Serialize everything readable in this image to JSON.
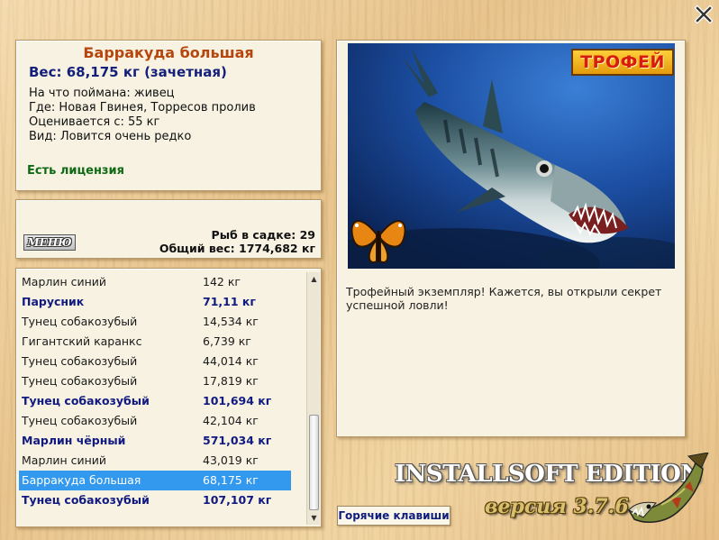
{
  "window": {
    "close_icon": "close-x-icon"
  },
  "info": {
    "title": "Барракуда большая",
    "weight_line": "Вес: 68,175 кг (зачетная)",
    "lines": [
      "На что поймана: живец",
      "Где: Новая Гвинея, Торресов пролив",
      "Оценивается с: 55 кг",
      "Вид: Ловится очень редко"
    ],
    "license": "Есть лицензия"
  },
  "stats": {
    "menu_label": "МЕНЮ",
    "fish_count": "Рыб в садке: 29",
    "total_weight": "Общий вес: 1774,682 кг"
  },
  "catch_list": {
    "rows": [
      {
        "name": "Марлин синий",
        "weight": "142 кг",
        "bold": false,
        "selected": false
      },
      {
        "name": "Парусник",
        "weight": "71,11 кг",
        "bold": true,
        "selected": false
      },
      {
        "name": "Тунец собакозубый",
        "weight": "14,534 кг",
        "bold": false,
        "selected": false
      },
      {
        "name": "Гигантский каранкс",
        "weight": "6,739 кг",
        "bold": false,
        "selected": false
      },
      {
        "name": "Тунец собакозубый",
        "weight": "44,014 кг",
        "bold": false,
        "selected": false
      },
      {
        "name": "Тунец собакозубый",
        "weight": "17,819 кг",
        "bold": false,
        "selected": false
      },
      {
        "name": "Тунец собакозубый",
        "weight": "101,694 кг",
        "bold": true,
        "selected": false
      },
      {
        "name": "Тунец собакозубый",
        "weight": "42,104 кг",
        "bold": false,
        "selected": false
      },
      {
        "name": "Марлин чёрный",
        "weight": "571,034 кг",
        "bold": true,
        "selected": false
      },
      {
        "name": "Марлин синий",
        "weight": "43,019 кг",
        "bold": false,
        "selected": false
      },
      {
        "name": "Барракуда большая",
        "weight": "68,175 кг",
        "bold": false,
        "selected": true
      },
      {
        "name": "Тунец собакозубый",
        "weight": "107,107 кг",
        "bold": true,
        "selected": false
      }
    ],
    "selection_color": "#3399ee",
    "bold_color": "#101a80"
  },
  "trophy": {
    "badge": "ТРОФЕЙ",
    "message": "Трофейный экземпляр! Кажется, вы открыли секрет успешной ловли!"
  },
  "footer": {
    "hotkeys": "Горячие клавиши",
    "edition": "INSTALLSOFT EDITION",
    "version": "версия 3.7.6"
  },
  "colors": {
    "title": "#b7460e",
    "weight": "#14207a",
    "license": "#0f6a16",
    "trophy_text": "#d81b0b"
  }
}
